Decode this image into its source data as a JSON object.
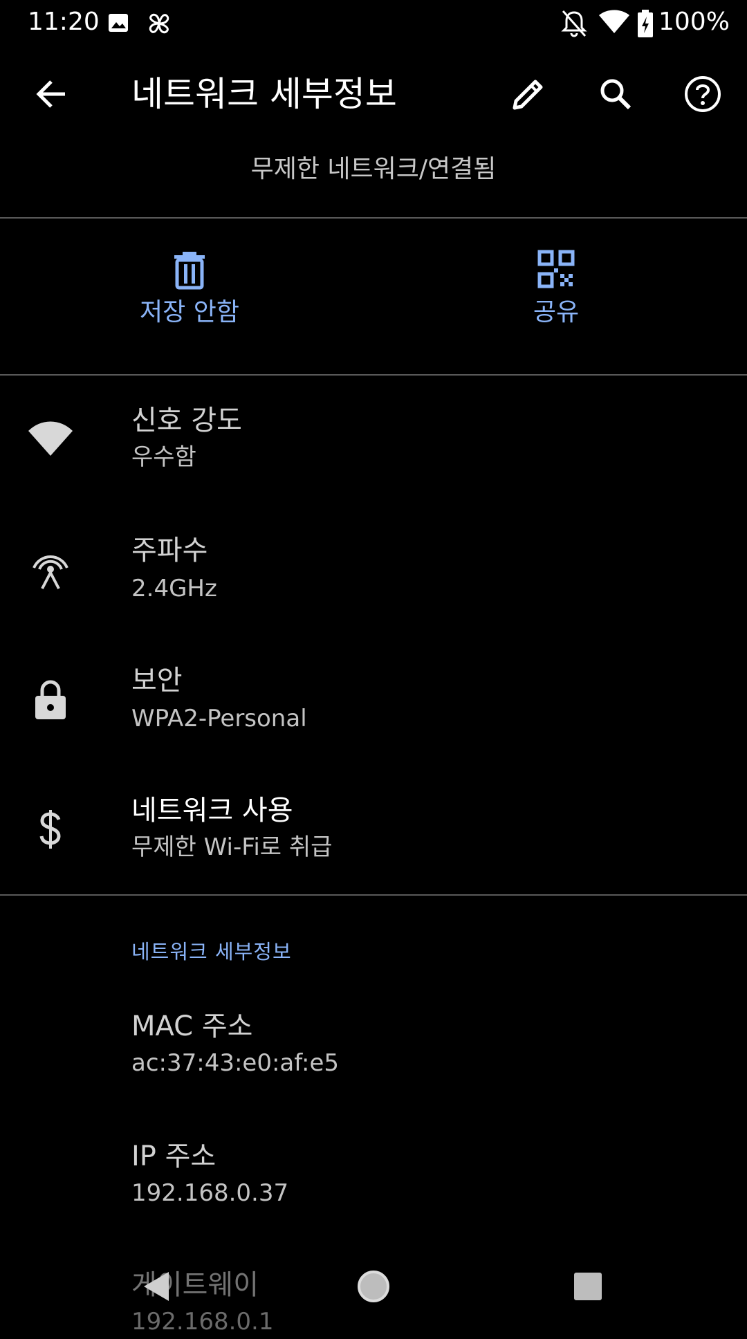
{
  "status_bar": {
    "time": "11:20",
    "battery": "100%",
    "icons": [
      "image-icon",
      "pinwheel-icon",
      "notifications-off-icon",
      "wifi-icon",
      "battery-charging-icon"
    ]
  },
  "app_bar": {
    "title": "네트워크 세부정보",
    "icons": [
      "back-arrow-icon",
      "edit-pencil-icon",
      "search-icon",
      "help-icon"
    ]
  },
  "subtitle": "무제한 네트워크/연결됨",
  "actions": [
    {
      "label": "저장 안함",
      "icon": "trash-icon"
    },
    {
      "label": "공유",
      "icon": "qr-code-icon"
    }
  ],
  "details": [
    {
      "title": "신호 강도",
      "value": "우수함",
      "icon": "wifi-signal-icon"
    },
    {
      "title": "주파수",
      "value": "2.4GHz",
      "icon": "antenna-icon"
    },
    {
      "title": "보안",
      "value": "WPA2-Personal",
      "icon": "lock-icon"
    },
    {
      "title": "네트워크 사용",
      "value": "무제한 Wi-Fi로 취급",
      "icon": "dollar-icon"
    }
  ],
  "network_details": {
    "header": "네트워크 세부정보",
    "items": [
      {
        "title": "MAC 주소",
        "value": "ac:37:43:e0:af:e5"
      },
      {
        "title": "IP 주소",
        "value": "192.168.0.37"
      },
      {
        "title": "게이트웨이",
        "value": "192.168.0.1"
      }
    ]
  },
  "nav_bar": {
    "icons": [
      "nav-back-icon",
      "nav-home-icon",
      "nav-recents-icon"
    ]
  },
  "colors": {
    "background": "#000000",
    "accent": "#8ab4f8",
    "divider": "#5a5a5a"
  }
}
